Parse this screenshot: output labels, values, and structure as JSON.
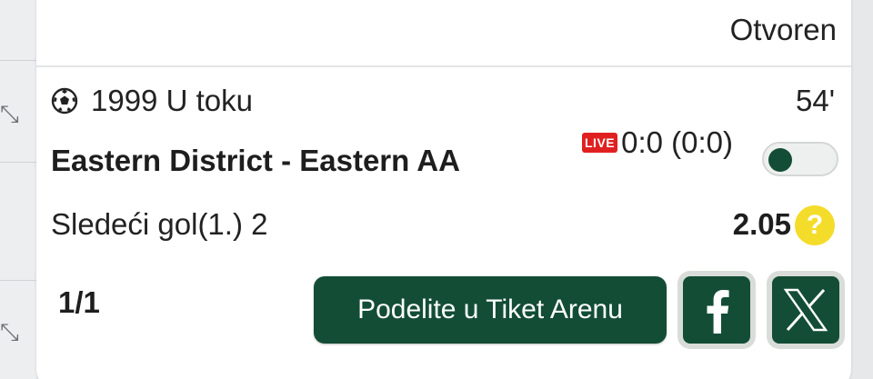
{
  "ticket": {
    "status": "Otvoren",
    "event_code": "1999",
    "event_state": "U toku",
    "minute": "54'",
    "teams": "Eastern District - Eastern AA",
    "live_label": "LIVE",
    "score": "0:0 (0:0)",
    "market": "Sledeći gol(1.) 2",
    "odds": "2.05",
    "help_symbol": "?",
    "page_count": "1/1"
  },
  "actions": {
    "share_label": "Podelite u Tiket Arenu",
    "facebook_icon": "facebook-icon",
    "x_icon": "x-icon"
  },
  "colors": {
    "accent": "#134d36",
    "live": "#e02020",
    "help": "#f4dc2a"
  }
}
